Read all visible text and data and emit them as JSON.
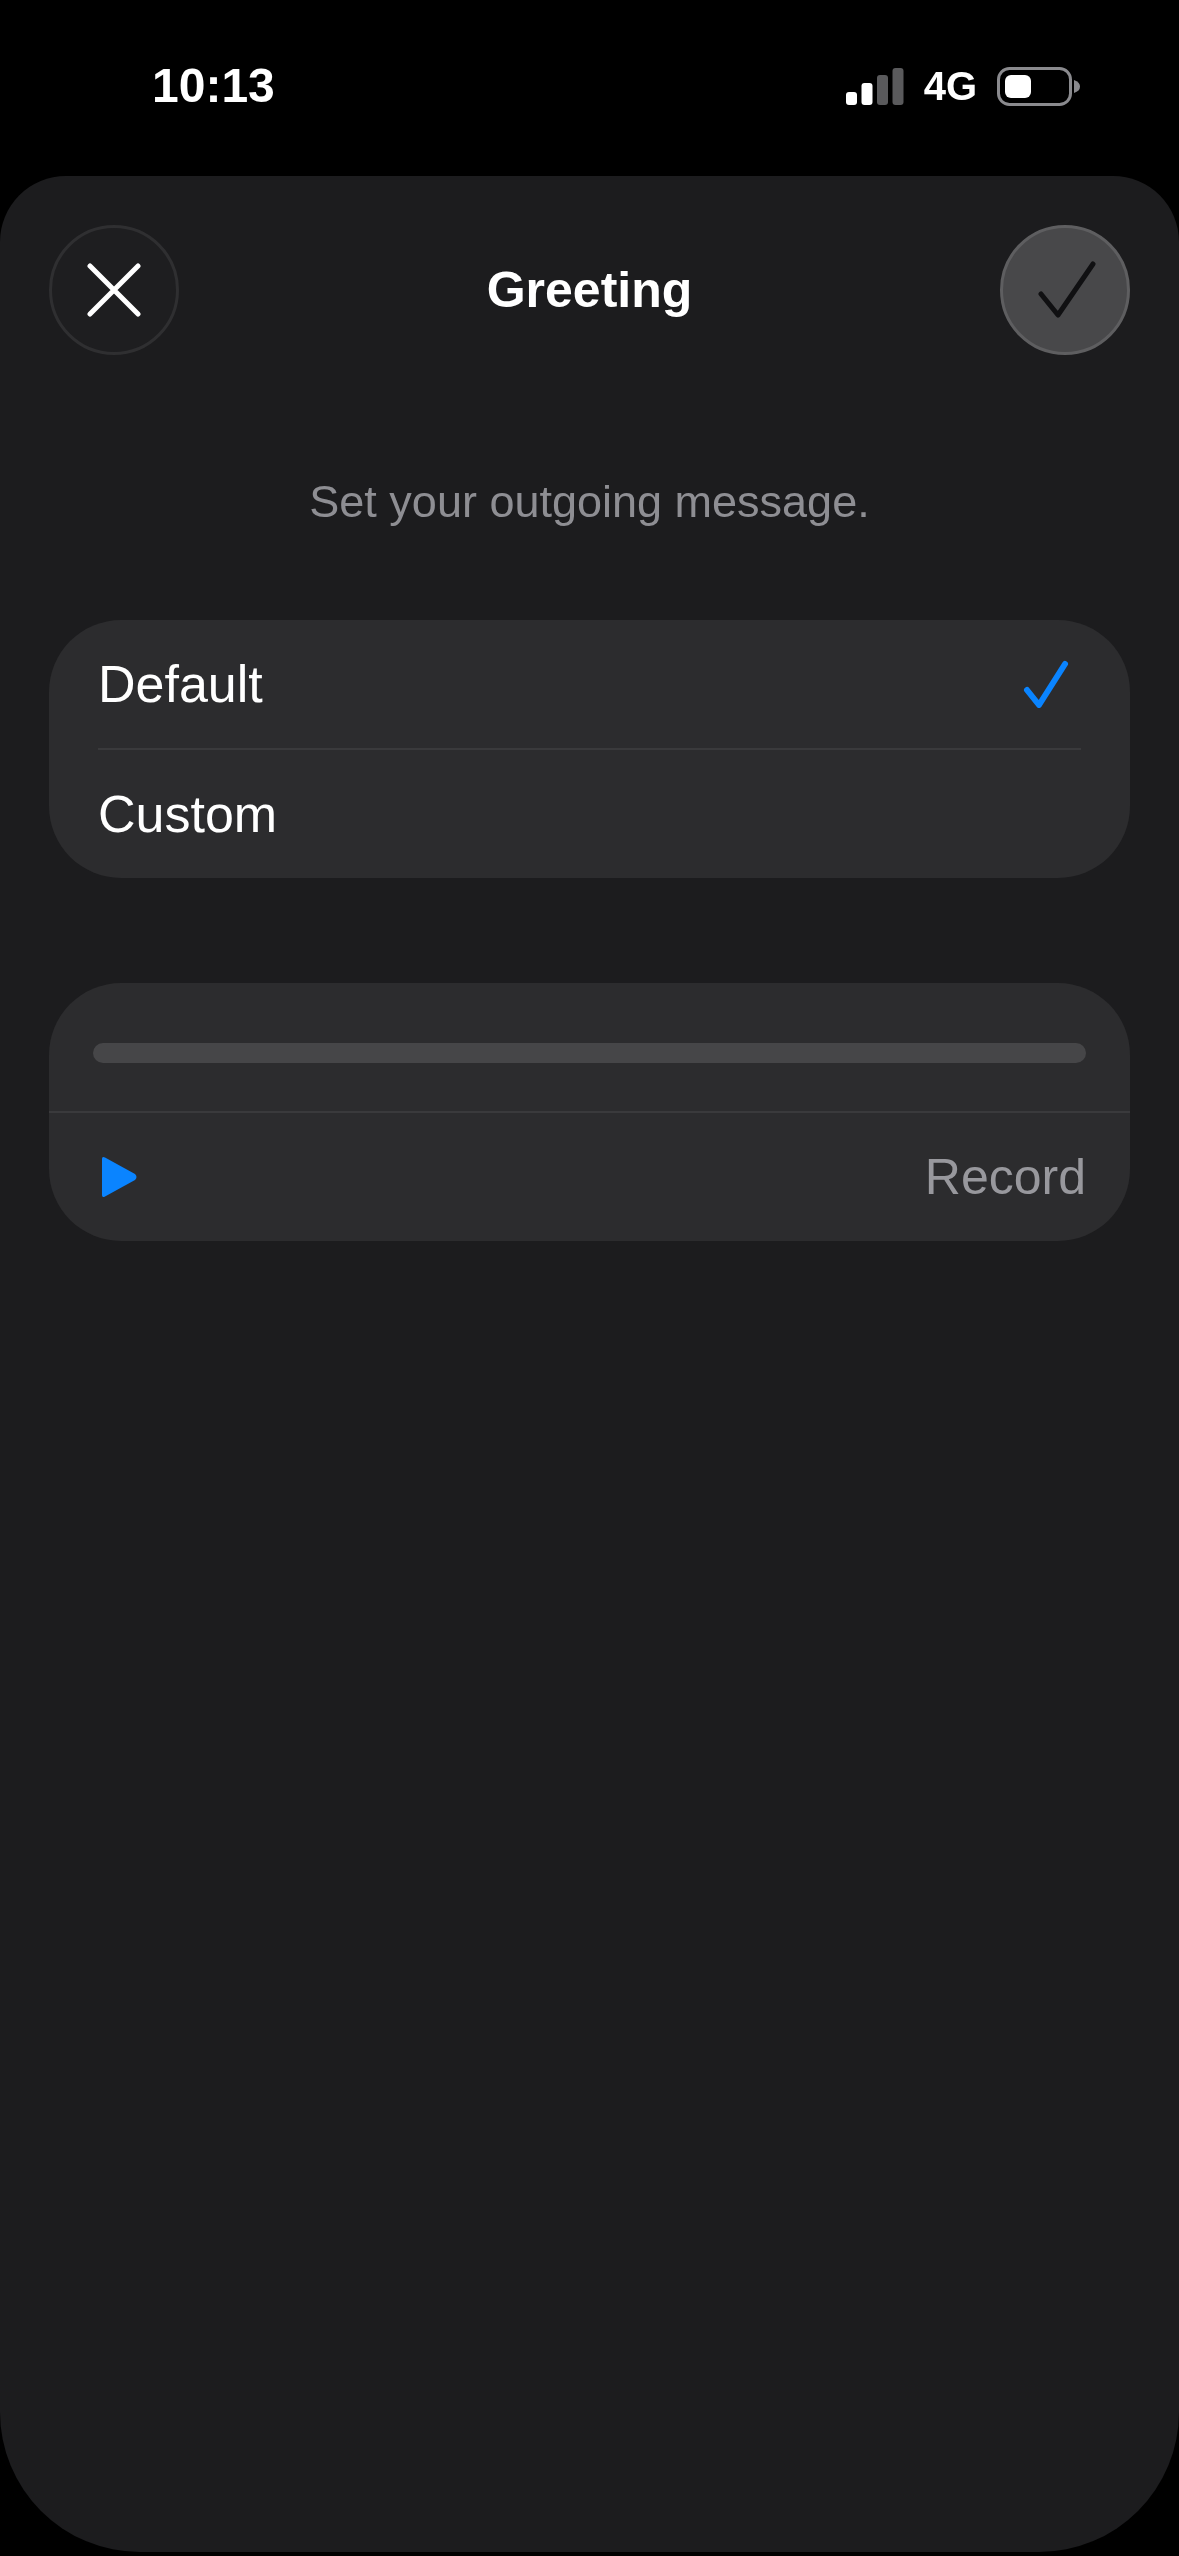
{
  "status_bar": {
    "time": "10:13",
    "network": "4G"
  },
  "sheet": {
    "title": "Greeting",
    "subtitle": "Set your outgoing message.",
    "options": [
      {
        "label": "Default",
        "selected": true
      },
      {
        "label": "Custom",
        "selected": false
      }
    ],
    "recording": {
      "action": "Record"
    }
  }
}
